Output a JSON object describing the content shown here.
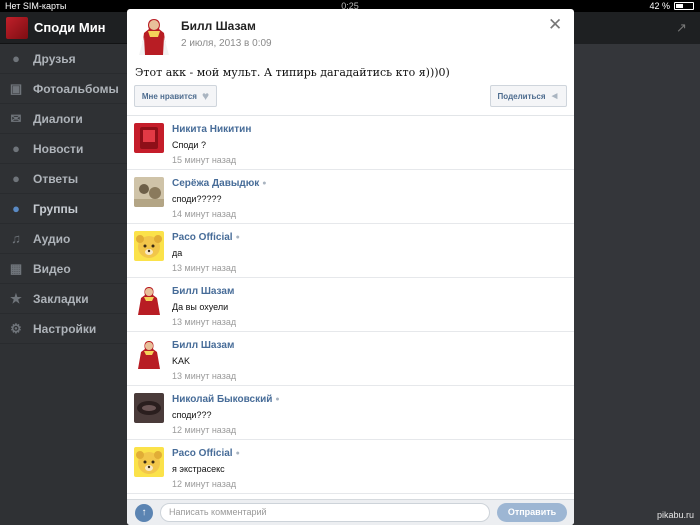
{
  "status_bar": {
    "carrier": "Нет SIM-карты",
    "time": "0:25",
    "battery": "42 %"
  },
  "sidebar": {
    "user_name": "Споди Мин",
    "items": [
      {
        "label": "Друзья",
        "icon": "person-icon"
      },
      {
        "label": "Фотоальбомы",
        "icon": "camera-icon"
      },
      {
        "label": "Диалоги",
        "icon": "envelope-icon"
      },
      {
        "label": "Новости",
        "icon": "speech-bubble-icon"
      },
      {
        "label": "Ответы",
        "icon": "chat-bubbles-icon"
      },
      {
        "label": "Группы",
        "icon": "group-icon"
      },
      {
        "label": "Аудио",
        "icon": "music-note-icon"
      },
      {
        "label": "Видео",
        "icon": "film-icon"
      },
      {
        "label": "Закладки",
        "icon": "star-icon"
      },
      {
        "label": "Настройки",
        "icon": "gear-icon"
      }
    ]
  },
  "post": {
    "author": "Билл Шазам",
    "date": "2 июля, 2013 в 0:09",
    "text": "Этот акк - мой мульт. А типирь дагадайтись кто я)))0)",
    "like_label": "Мне нравится",
    "share_label": "Поделиться"
  },
  "comments": [
    {
      "name": "Никита Никитин",
      "text": "Споди ?",
      "time": "15 минут назад",
      "online": false,
      "avatar": "red-phone"
    },
    {
      "name": "Серёжа Давыдюк",
      "text": "споди?????",
      "time": "14 минут назад",
      "online": true,
      "avatar": "photo"
    },
    {
      "name": "Paco Official",
      "text": "да",
      "time": "13 минут назад",
      "online": true,
      "avatar": "bear"
    },
    {
      "name": "Билл Шазам",
      "text": "Да вы охуели",
      "time": "13 минут назад",
      "online": false,
      "avatar": "hero"
    },
    {
      "name": "Билл Шазам",
      "text": "KAK",
      "time": "13 минут назад",
      "online": false,
      "avatar": "hero"
    },
    {
      "name": "Николай Быковский",
      "text": "споди???",
      "time": "12 минут назад",
      "online": true,
      "avatar": "dark"
    },
    {
      "name": "Paco Official",
      "text": "я экстрасекс",
      "time": "12 минут назад",
      "online": true,
      "avatar": "bear"
    }
  ],
  "compose": {
    "placeholder": "Написать комментарий",
    "send_label": "Отправить"
  },
  "watermark": "pikabu.ru",
  "colors": {
    "accent": "#476c98",
    "sidebar_bg": "#2f3134",
    "send_button": "#9db6d3"
  }
}
